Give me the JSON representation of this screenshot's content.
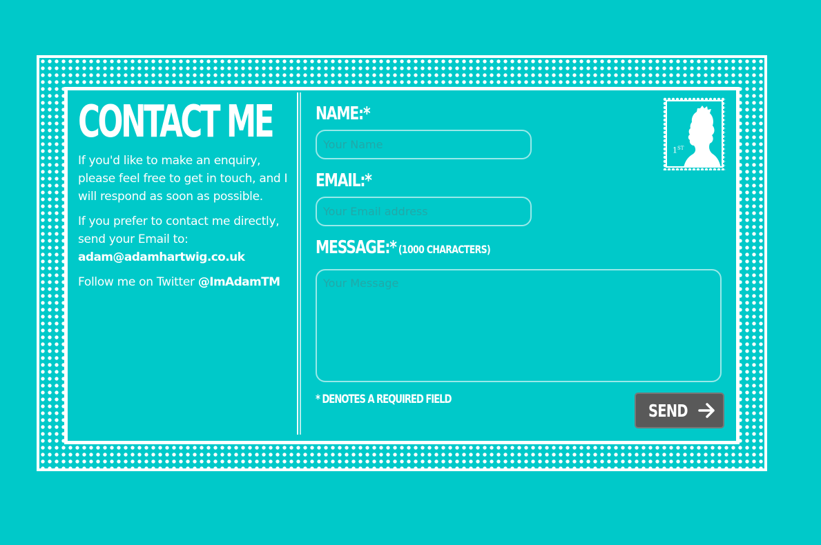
{
  "page": {
    "background_color": "#00c9c9",
    "accent_button_color": "#595959"
  },
  "contact": {
    "title": "CONTACT ME",
    "intro": "If you'd like to make an enquiry, please feel free to get in touch, and I will respond as soon as possible.",
    "direct_text": "If you prefer to contact me directly, send your Email to:",
    "email": "adam@adamhartwig.co.uk",
    "follow_text": "Follow me on Twitter ",
    "twitter_handle": "@ImAdamTM"
  },
  "form": {
    "name_label": "NAME:*",
    "name_placeholder": "Your Name",
    "email_label": "EMAIL:*",
    "email_placeholder": "Your Email address",
    "message_label": "MESSAGE:*",
    "message_hint": "(1000 CHARACTERS)",
    "message_placeholder": "Your Message",
    "required_note": "* DENOTES A REQUIRED FIELD",
    "send_label": "SEND"
  },
  "stamp": {
    "value": "1",
    "value_suffix": "ST",
    "icon": "queen-silhouette-icon"
  }
}
